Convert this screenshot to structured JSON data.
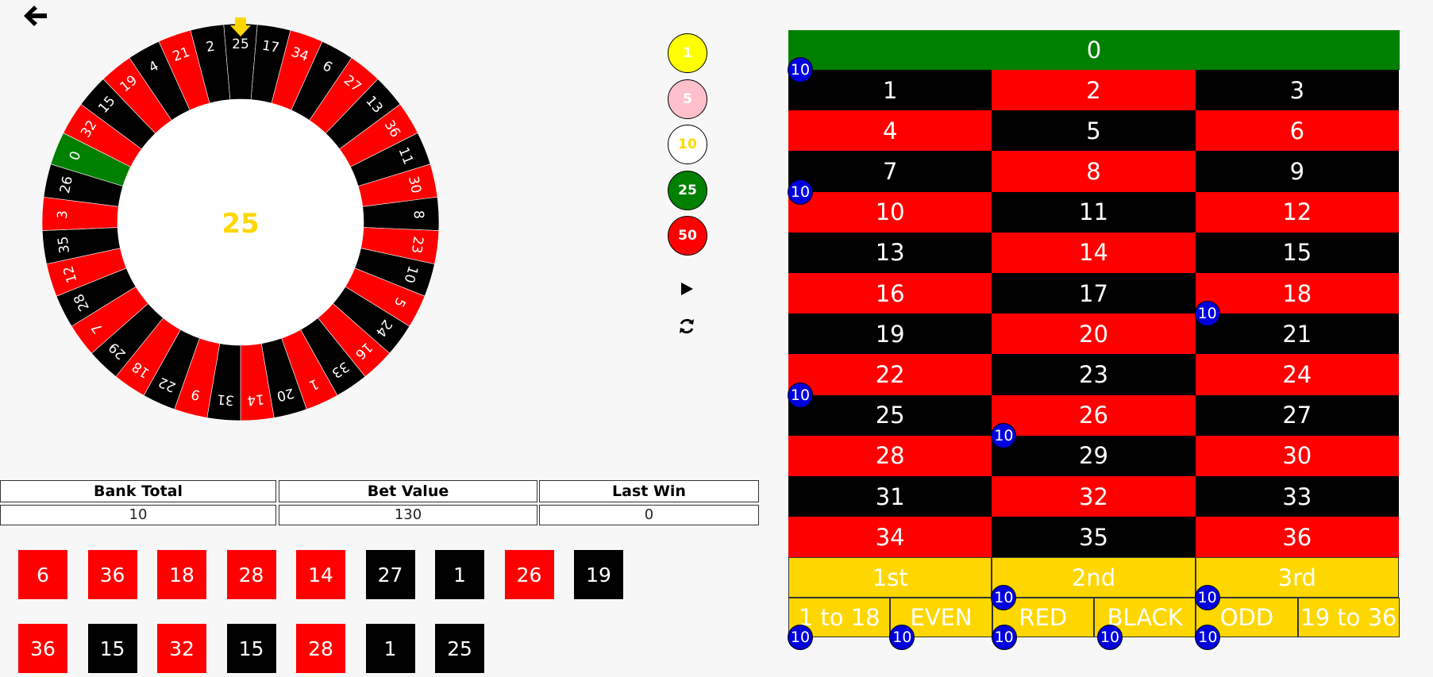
{
  "wheel": {
    "result": "25",
    "order": [
      "0",
      "32",
      "15",
      "19",
      "4",
      "21",
      "2",
      "25",
      "17",
      "34",
      "6",
      "27",
      "13",
      "36",
      "11",
      "30",
      "8",
      "23",
      "10",
      "5",
      "24",
      "16",
      "33",
      "1",
      "20",
      "14",
      "31",
      "9",
      "22",
      "18",
      "29",
      "7",
      "28",
      "12",
      "35",
      "3",
      "26"
    ],
    "colors": {
      "red": "#ff0000",
      "black": "#000000",
      "green": "#008000",
      "pointer": "#ffd700",
      "result_text": "#ffd700"
    }
  },
  "chips": [
    {
      "value": "1",
      "bg": "#ffff00",
      "fg": "#ffffff"
    },
    {
      "value": "5",
      "bg": "#ffc0cb",
      "fg": "#ffffff"
    },
    {
      "value": "10",
      "bg": "#ffffff",
      "fg": "#ffd700"
    },
    {
      "value": "25",
      "bg": "#008000",
      "fg": "#ffffff"
    },
    {
      "value": "50",
      "bg": "#ff0000",
      "fg": "#ffffff"
    }
  ],
  "controls": {
    "play_icon": "play-icon",
    "respin_icon": "refresh-icon",
    "back_icon": "arrow-left-icon"
  },
  "board": {
    "zero": "0",
    "numbers": [
      [
        "1",
        "black"
      ],
      [
        "2",
        "red"
      ],
      [
        "3",
        "black"
      ],
      [
        "4",
        "red"
      ],
      [
        "5",
        "black"
      ],
      [
        "6",
        "red"
      ],
      [
        "7",
        "black"
      ],
      [
        "8",
        "red"
      ],
      [
        "9",
        "black"
      ],
      [
        "10",
        "red"
      ],
      [
        "11",
        "black"
      ],
      [
        "12",
        "red"
      ],
      [
        "13",
        "black"
      ],
      [
        "14",
        "red"
      ],
      [
        "15",
        "black"
      ],
      [
        "16",
        "red"
      ],
      [
        "17",
        "black"
      ],
      [
        "18",
        "red"
      ],
      [
        "19",
        "black"
      ],
      [
        "20",
        "red"
      ],
      [
        "21",
        "black"
      ],
      [
        "22",
        "red"
      ],
      [
        "23",
        "black"
      ],
      [
        "24",
        "red"
      ],
      [
        "25",
        "black"
      ],
      [
        "26",
        "red"
      ],
      [
        "27",
        "black"
      ],
      [
        "28",
        "red"
      ],
      [
        "29",
        "black"
      ],
      [
        "30",
        "red"
      ],
      [
        "31",
        "black"
      ],
      [
        "32",
        "red"
      ],
      [
        "33",
        "black"
      ],
      [
        "34",
        "red"
      ],
      [
        "35",
        "black"
      ],
      [
        "36",
        "red"
      ]
    ],
    "dozens": [
      "1st",
      "2nd",
      "3rd"
    ],
    "outside": [
      "1 to 18",
      "EVEN",
      "RED",
      "BLACK",
      "ODD",
      "19 to 36"
    ],
    "bets": [
      {
        "on": "0",
        "value": "10"
      },
      {
        "on": "7",
        "value": "10"
      },
      {
        "on": "18",
        "value": "10"
      },
      {
        "on": "22",
        "value": "10"
      },
      {
        "on": "26",
        "value": "10"
      },
      {
        "on": "2nd",
        "value": "10"
      },
      {
        "on": "3rd",
        "value": "10"
      },
      {
        "on": "1 to 18",
        "value": "10"
      },
      {
        "on": "EVEN",
        "value": "10"
      },
      {
        "on": "RED",
        "value": "10"
      },
      {
        "on": "RED-BLACK",
        "value": "10"
      },
      {
        "on": "ODD",
        "value": "10"
      }
    ]
  },
  "info": {
    "bank_total_label": "Bank Total",
    "bet_value_label": "Bet Value",
    "last_win_label": "Last Win",
    "bank_total": "10",
    "bet_value": "130",
    "last_win": "0"
  },
  "history": [
    [
      [
        "6",
        "red"
      ],
      [
        "36",
        "red"
      ],
      [
        "18",
        "red"
      ],
      [
        "28",
        "red"
      ],
      [
        "14",
        "red"
      ],
      [
        "27",
        "black"
      ],
      [
        "1",
        "black"
      ],
      [
        "26",
        "red"
      ],
      [
        "19",
        "black"
      ]
    ],
    [
      [
        "36",
        "red"
      ],
      [
        "15",
        "black"
      ],
      [
        "32",
        "red"
      ],
      [
        "15",
        "black"
      ],
      [
        "28",
        "red"
      ],
      [
        "1",
        "black"
      ],
      [
        "25",
        "black"
      ]
    ]
  ]
}
